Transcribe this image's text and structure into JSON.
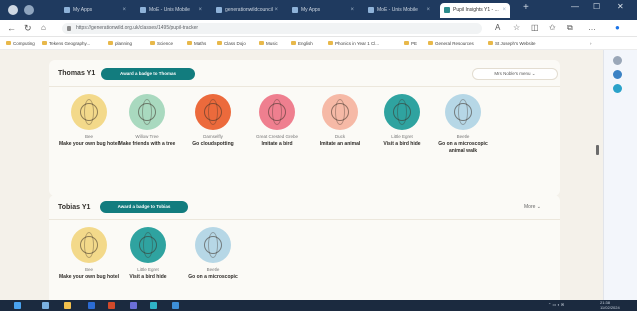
{
  "browser": {
    "tabs": [
      {
        "label": "My Apps"
      },
      {
        "label": "MoE - Unis Mobile"
      },
      {
        "label": "generationwildcouncil"
      },
      {
        "label": "My Apps"
      },
      {
        "label": "MoE - Unis Mobile"
      },
      {
        "label": "Pupil Insights Y1 - ..."
      }
    ],
    "url": "https://generationwild.org.uk/classes/1495/pupil-tracker",
    "bookmarks": [
      {
        "label": "Computing"
      },
      {
        "label": "Tekens Geography..."
      },
      {
        "label": "planning"
      },
      {
        "label": "Science"
      },
      {
        "label": "Maths"
      },
      {
        "label": "Class Dojo"
      },
      {
        "label": "Music"
      },
      {
        "label": "English"
      },
      {
        "label": "Phonics in Year 1 Cl..."
      },
      {
        "label": "PE"
      },
      {
        "label": "General Resources"
      },
      {
        "label": "St Joseph's Website"
      }
    ]
  },
  "classes": [
    {
      "name": "Thomas Y1",
      "award_label": "Award a badge to Thomas",
      "menu_label": "Mrs Noble's menu",
      "badges": [
        {
          "name": "Bee",
          "task": "Make your own bug hotel",
          "color": "#f3d98a"
        },
        {
          "name": "Willow Tree",
          "task": "Make friends with a tree",
          "color": "#a9d9bf"
        },
        {
          "name": "Damselfly",
          "task": "Go cloudspotting",
          "color": "#ec6a3c"
        },
        {
          "name": "Great Crested Grebe",
          "task": "Imitate a bird",
          "color": "#ef7f8f"
        },
        {
          "name": "Duck",
          "task": "Imitate an animal",
          "color": "#f6b9a6"
        },
        {
          "name": "Little Egret",
          "task": "Visit a bird hide",
          "color": "#2fa3a0"
        },
        {
          "name": "Beetle",
          "task": "Go on a microscopic animal walk",
          "color": "#b6d7e6"
        }
      ]
    },
    {
      "name": "Tobias Y1",
      "award_label": "Award a badge to Tobias",
      "menu_label": "More",
      "badges": [
        {
          "name": "Bee",
          "task": "Make your own bug hotel",
          "color": "#f3d98a"
        },
        {
          "name": "Little Egret",
          "task": "Visit a bird hide",
          "color": "#2fa3a0"
        },
        {
          "name": "Beetle",
          "task": "Go on a microscopic",
          "color": "#b6d7e6"
        }
      ]
    }
  ],
  "taskbar": {
    "time": "21:38",
    "date": "11/02/2024"
  }
}
